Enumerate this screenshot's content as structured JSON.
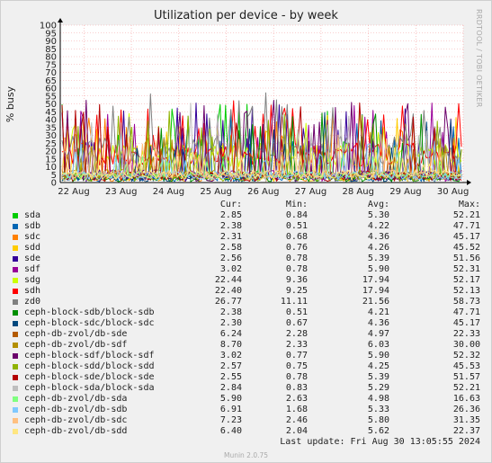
{
  "chart_data": {
    "type": "line",
    "title": "Utilization per device - by week",
    "ylabel": "% busy",
    "ylim": [
      0,
      100
    ],
    "yticks": [
      "0",
      "5",
      "10",
      "15",
      "20",
      "25",
      "30",
      "35",
      "40",
      "45",
      "50",
      "55",
      "60",
      "65",
      "70",
      "75",
      "80",
      "85",
      "90",
      "95",
      "100"
    ],
    "xticks": [
      "22 Aug",
      "23 Aug",
      "24 Aug",
      "25 Aug",
      "26 Aug",
      "27 Aug",
      "28 Aug",
      "29 Aug",
      "30 Aug"
    ],
    "grid": true,
    "series": [
      {
        "name": "sda",
        "color": "#00cc00",
        "cur": "2.85",
        "min": "0.84",
        "avg": "5.30",
        "max": "52.21"
      },
      {
        "name": "sdb",
        "color": "#0066b3",
        "cur": "2.38",
        "min": "0.51",
        "avg": "4.22",
        "max": "47.71"
      },
      {
        "name": "sdc",
        "color": "#ff8000",
        "cur": "2.31",
        "min": "0.68",
        "avg": "4.36",
        "max": "45.17"
      },
      {
        "name": "sdd",
        "color": "#ffcc00",
        "cur": "2.58",
        "min": "0.76",
        "avg": "4.26",
        "max": "45.52"
      },
      {
        "name": "sde",
        "color": "#330099",
        "cur": "2.56",
        "min": "0.78",
        "avg": "5.39",
        "max": "51.56"
      },
      {
        "name": "sdf",
        "color": "#990099",
        "cur": "3.02",
        "min": "0.78",
        "avg": "5.90",
        "max": "52.31"
      },
      {
        "name": "sdg",
        "color": "#ccff00",
        "cur": "22.44",
        "min": "9.36",
        "avg": "17.94",
        "max": "52.17"
      },
      {
        "name": "sdh",
        "color": "#ff0000",
        "cur": "22.40",
        "min": "9.25",
        "avg": "17.94",
        "max": "52.13"
      },
      {
        "name": "zd0",
        "color": "#808080",
        "cur": "26.77",
        "min": "11.11",
        "avg": "21.56",
        "max": "58.73"
      },
      {
        "name": "ceph-block-sdb/block-sdb",
        "color": "#008f00",
        "cur": "2.38",
        "min": "0.51",
        "avg": "4.21",
        "max": "47.71"
      },
      {
        "name": "ceph-block-sdc/block-sdc",
        "color": "#00487d",
        "cur": "2.30",
        "min": "0.67",
        "avg": "4.36",
        "max": "45.17"
      },
      {
        "name": "ceph-db-zvol/db-sde",
        "color": "#b35a00",
        "cur": "6.24",
        "min": "2.28",
        "avg": "4.97",
        "max": "22.33"
      },
      {
        "name": "ceph-db-zvol/db-sdf",
        "color": "#b38f00",
        "cur": "8.70",
        "min": "2.33",
        "avg": "6.03",
        "max": "30.00"
      },
      {
        "name": "ceph-block-sdf/block-sdf",
        "color": "#6b006b",
        "cur": "3.02",
        "min": "0.77",
        "avg": "5.90",
        "max": "52.32"
      },
      {
        "name": "ceph-block-sdd/block-sdd",
        "color": "#8fb300",
        "cur": "2.57",
        "min": "0.75",
        "avg": "4.25",
        "max": "45.53"
      },
      {
        "name": "ceph-block-sde/block-sde",
        "color": "#b30000",
        "cur": "2.55",
        "min": "0.78",
        "avg": "5.39",
        "max": "51.57"
      },
      {
        "name": "ceph-block-sda/block-sda",
        "color": "#bebebe",
        "cur": "2.84",
        "min": "0.83",
        "avg": "5.29",
        "max": "52.21"
      },
      {
        "name": "ceph-db-zvol/db-sda",
        "color": "#80ff80",
        "cur": "5.90",
        "min": "2.63",
        "avg": "4.98",
        "max": "16.63"
      },
      {
        "name": "ceph-db-zvol/db-sdb",
        "color": "#80c9ff",
        "cur": "6.91",
        "min": "1.68",
        "avg": "5.33",
        "max": "26.36"
      },
      {
        "name": "ceph-db-zvol/db-sdc",
        "color": "#ffc080",
        "cur": "7.23",
        "min": "2.46",
        "avg": "5.80",
        "max": "31.35"
      },
      {
        "name": "ceph-db-zvol/db-sdd",
        "color": "#ffe680",
        "cur": "6.40",
        "min": "2.04",
        "avg": "5.62",
        "max": "22.37"
      }
    ]
  },
  "legend_headers": {
    "cur": "Cur:",
    "min": "Min:",
    "avg": "Avg:",
    "max": "Max:"
  },
  "side_credit": "RRDTOOL / TOBI OETIKER",
  "last_update": "Last update:  Fri Aug 30 13:05:55 2024",
  "footer": "Munin 2.0.75"
}
